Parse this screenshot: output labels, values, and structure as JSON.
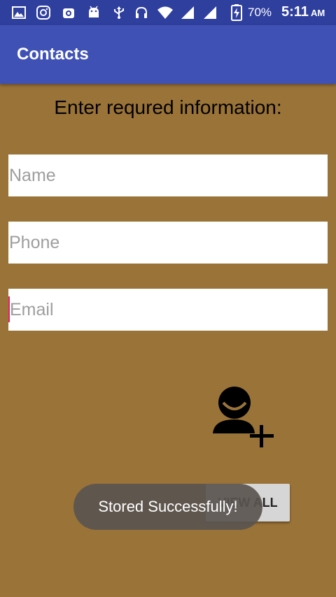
{
  "status_bar": {
    "battery_percent": "70%",
    "time": "5:11",
    "ampm": "AM"
  },
  "app_bar": {
    "title": "Contacts"
  },
  "form": {
    "prompt": "Enter requred information:",
    "name_placeholder": "Name",
    "phone_placeholder": "Phone",
    "email_placeholder": "Email",
    "name_value": "",
    "phone_value": "",
    "email_value": ""
  },
  "actions": {
    "add_contact_icon": "add-person-icon",
    "view_all_label": "VIEW ALL"
  },
  "toast": {
    "message": "Stored Successfully!"
  },
  "colors": {
    "status_bar": "#2f3f9e",
    "app_bar": "#3f51b5",
    "background": "#9a7338",
    "cursor": "#e91e63",
    "toast": "#5a5550"
  }
}
